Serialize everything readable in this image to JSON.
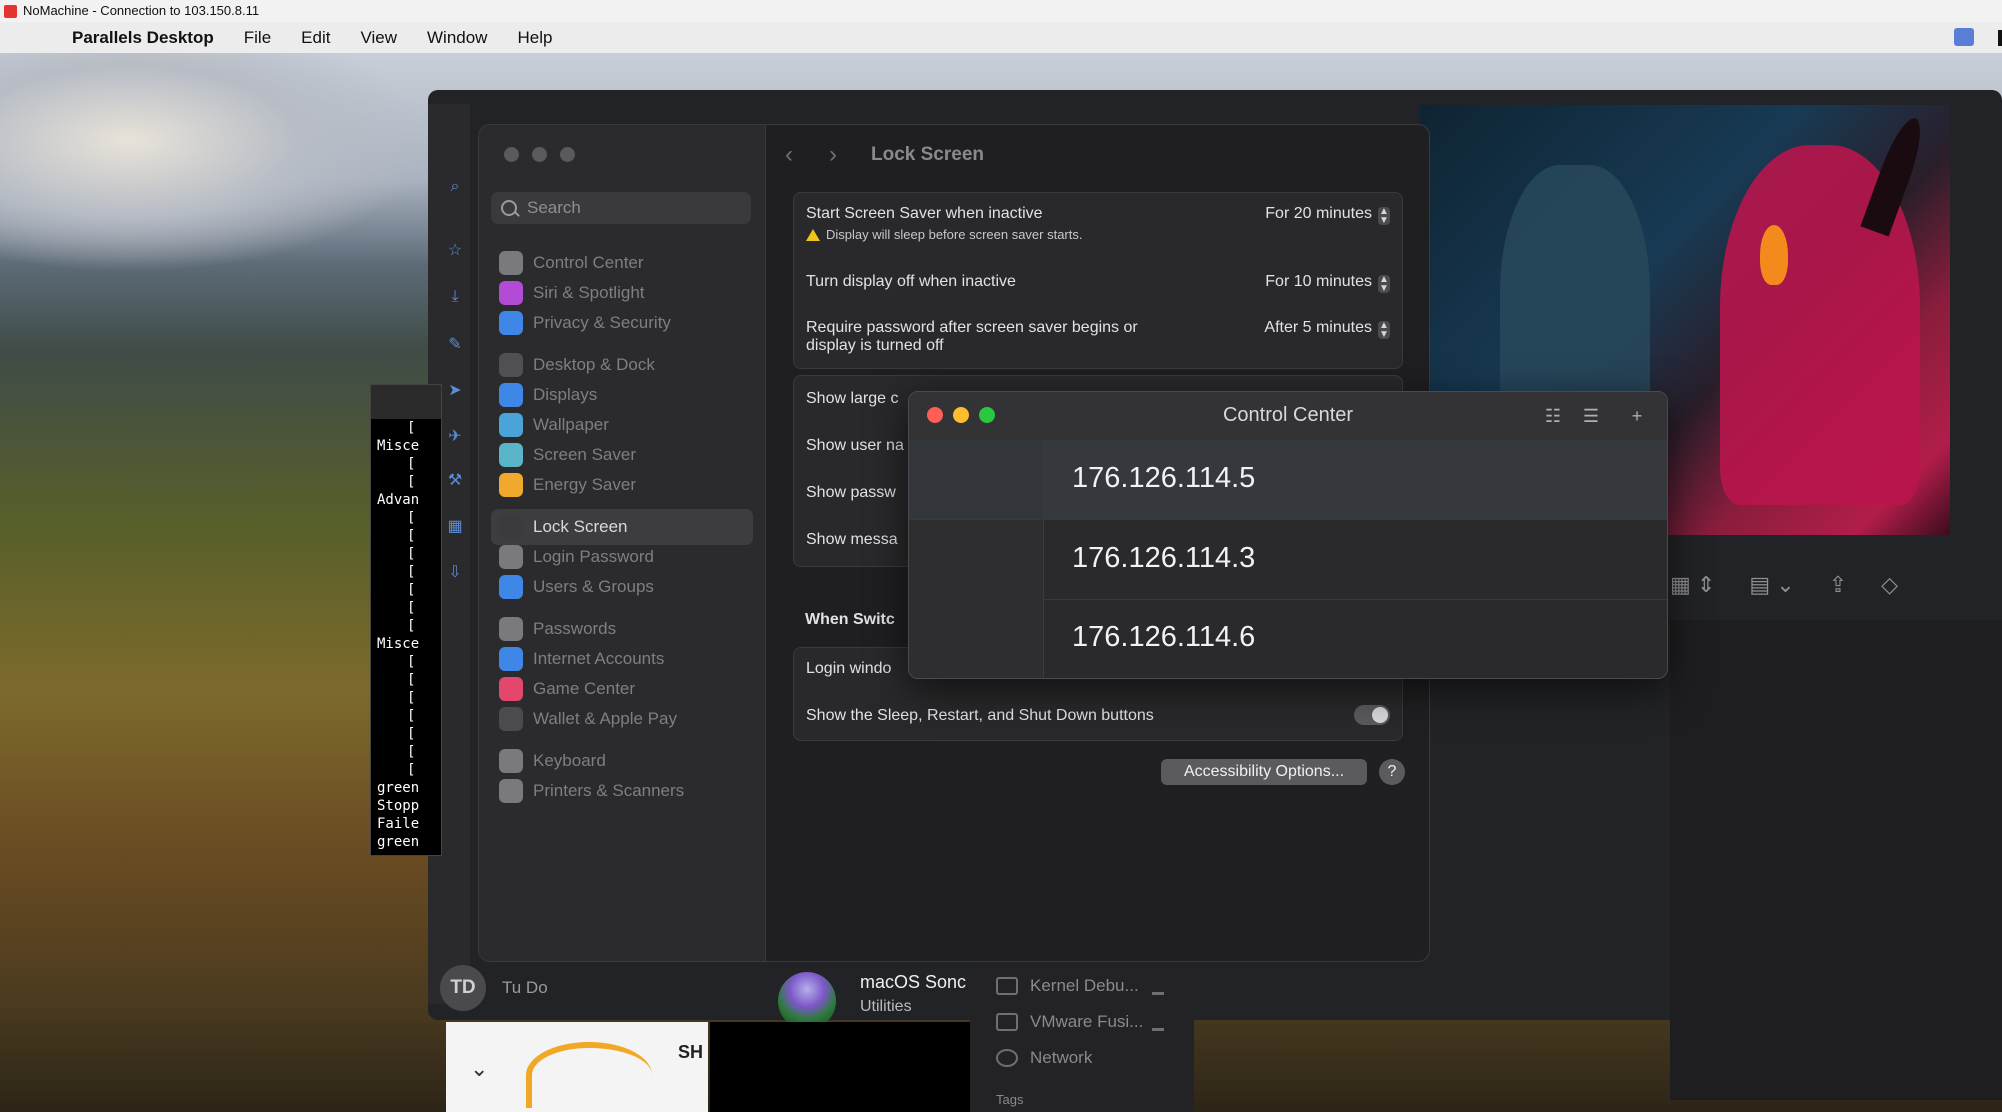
{
  "nomachine": {
    "title": "NoMachine - Connection to 103.150.8.11"
  },
  "menubar": {
    "app": "Parallels Desktop",
    "items": [
      "File",
      "Edit",
      "View",
      "Window",
      "Help"
    ]
  },
  "settings": {
    "search_placeholder": "Search",
    "title": "Lock Screen",
    "sidebar": [
      {
        "label": "Control Center",
        "icon": "control-center-icon",
        "color": "#7a7a7e"
      },
      {
        "label": "Siri & Spotlight",
        "icon": "siri-icon",
        "color": "#b24bd6"
      },
      {
        "label": "Privacy & Security",
        "icon": "hand-icon",
        "color": "#3f87e6"
      },
      {
        "label": "Desktop & Dock",
        "icon": "dock-icon",
        "color": "#505054"
      },
      {
        "label": "Displays",
        "icon": "sun-icon",
        "color": "#3f87e6"
      },
      {
        "label": "Wallpaper",
        "icon": "flower-icon",
        "color": "#4aa4d8"
      },
      {
        "label": "Screen Saver",
        "icon": "screen-saver-icon",
        "color": "#5ab5c8"
      },
      {
        "label": "Energy Saver",
        "icon": "bulb-icon",
        "color": "#f0a92c"
      },
      {
        "label": "Lock Screen",
        "icon": "lock-icon",
        "color": "#3b3b3e"
      },
      {
        "label": "Login Password",
        "icon": "lock-icon",
        "color": "#7a7a7e"
      },
      {
        "label": "Users & Groups",
        "icon": "users-icon",
        "color": "#3f87e6"
      },
      {
        "label": "Passwords",
        "icon": "key-icon",
        "color": "#7a7a7e"
      },
      {
        "label": "Internet Accounts",
        "icon": "at-icon",
        "color": "#3f87e6"
      },
      {
        "label": "Game Center",
        "icon": "game-center-icon",
        "color": "#e3476d"
      },
      {
        "label": "Wallet & Apple Pay",
        "icon": "wallet-icon",
        "color": "#4b4b4e"
      },
      {
        "label": "Keyboard",
        "icon": "keyboard-icon",
        "color": "#7a7a7e"
      },
      {
        "label": "Printers & Scanners",
        "icon": "printer-icon",
        "color": "#7a7a7e"
      }
    ],
    "rows": {
      "screensaver_label": "Start Screen Saver when inactive",
      "screensaver_value": "For 20 minutes",
      "screensaver_warning": "Display will sleep before screen saver starts.",
      "display_off_label": "Turn display off when inactive",
      "display_off_value": "For 10 minutes",
      "require_pw_label": "Require password after screen saver begins or display is turned off",
      "require_pw_value": "After 5 minutes",
      "show_large": "Show large c",
      "show_user": "Show user na",
      "show_passw": "Show passw",
      "show_messa": "Show messa",
      "when_switch": "When Switc",
      "login_window": "Login windo",
      "sleep_restart": "Show the Sleep, Restart, and Shut Down buttons"
    },
    "accessibility_button": "Accessibility Options...",
    "help_button": "?"
  },
  "control_center": {
    "title": "Control Center",
    "hosts": [
      "176.126.114.5",
      "176.126.114.3",
      "176.126.114.6"
    ]
  },
  "terminal": {
    "lines": [
      "[",
      "Misce",
      "[",
      "[",
      "Advan",
      "[",
      "[",
      "[",
      "[",
      "[",
      "[",
      "[",
      "Misce",
      "[",
      "[",
      "[",
      "[",
      "[",
      "[",
      "[",
      "green",
      "Stopp",
      "Faile",
      "green"
    ]
  },
  "user": {
    "initials": "TD",
    "name": "Tu Do"
  },
  "vm": {
    "name": "macOS Sonc",
    "sub": "Utilities"
  },
  "finder_sidebar": [
    "Kernel Debu...",
    "VMware Fusi...",
    "Network"
  ],
  "finder_extra": "Tags",
  "doc_preview": {
    "text": "SH"
  }
}
